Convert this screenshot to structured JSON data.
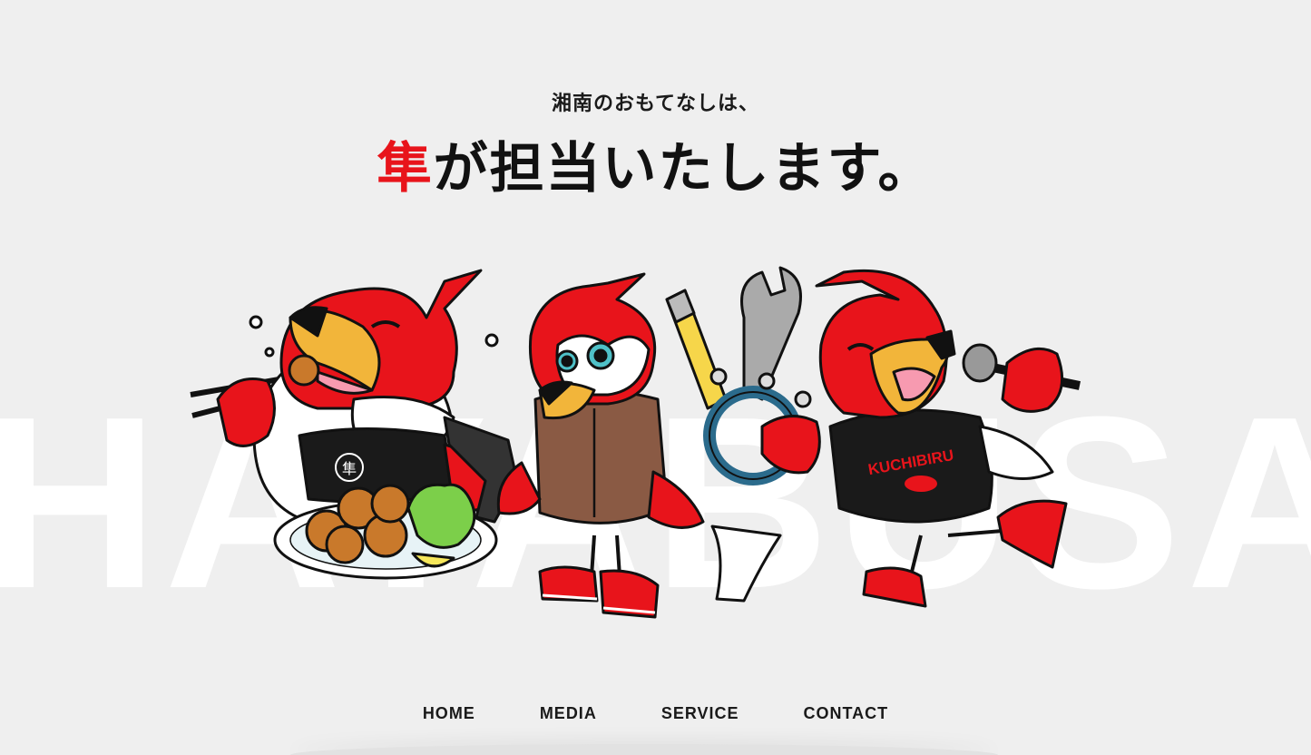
{
  "hero": {
    "subtitle": "湘南のおもてなしは、",
    "headline_accent": "隼",
    "headline_rest": "が担当いたします。",
    "background_word": "HAYABUSA",
    "accent_color": "#e8141b",
    "mascot_shirt_text": "KUCHIBIRU",
    "mascot_emblem_text": "隼"
  },
  "nav": {
    "items": [
      {
        "label": "HOME"
      },
      {
        "label": "MEDIA"
      },
      {
        "label": "SERVICE"
      },
      {
        "label": "CONTACT"
      }
    ]
  }
}
